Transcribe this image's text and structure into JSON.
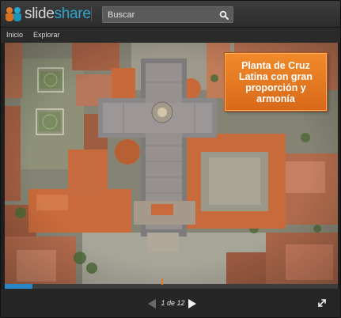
{
  "app": {
    "logo_prefix": "slide",
    "logo_suffix": "share",
    "brand_colors": {
      "orange": "#e07b27",
      "blue": "#2aa8d0"
    }
  },
  "search": {
    "placeholder": "Buscar",
    "icon": "search-icon"
  },
  "nav": {
    "items": [
      {
        "label": "Inicio"
      },
      {
        "label": "Explorar"
      }
    ]
  },
  "slide": {
    "callout_text": "Planta de Cruz\nLatina con gran\nproporción y\narmonía",
    "callout_color": "#e97f25",
    "image": "aerial-view-cathedral-cross-plan"
  },
  "player": {
    "page_indicator": "1 de 12",
    "current_page": 1,
    "total_pages": 12,
    "progress_fraction": 0.083,
    "progress_color": "#2a86c8",
    "prev_icon": "triangle-left-icon",
    "next_icon": "triangle-right-icon",
    "fullscreen_icon": "expand-arrows-icon"
  }
}
